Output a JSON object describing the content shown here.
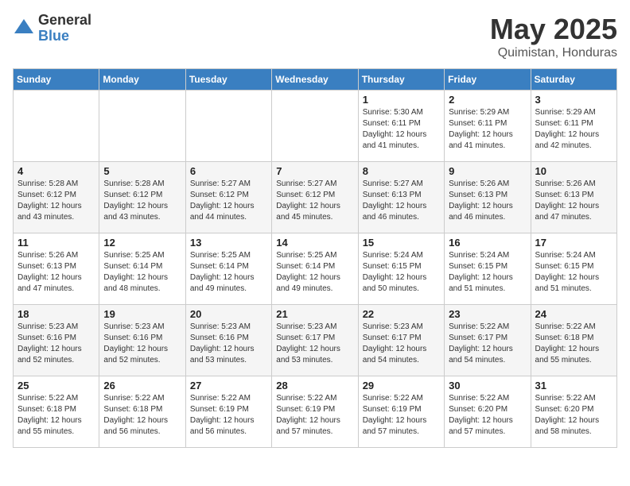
{
  "logo": {
    "general": "General",
    "blue": "Blue"
  },
  "title": "May 2025",
  "location": "Quimistan, Honduras",
  "days_of_week": [
    "Sunday",
    "Monday",
    "Tuesday",
    "Wednesday",
    "Thursday",
    "Friday",
    "Saturday"
  ],
  "weeks": [
    [
      {
        "day": "",
        "info": ""
      },
      {
        "day": "",
        "info": ""
      },
      {
        "day": "",
        "info": ""
      },
      {
        "day": "",
        "info": ""
      },
      {
        "day": "1",
        "info": "Sunrise: 5:30 AM\nSunset: 6:11 PM\nDaylight: 12 hours\nand 41 minutes."
      },
      {
        "day": "2",
        "info": "Sunrise: 5:29 AM\nSunset: 6:11 PM\nDaylight: 12 hours\nand 41 minutes."
      },
      {
        "day": "3",
        "info": "Sunrise: 5:29 AM\nSunset: 6:11 PM\nDaylight: 12 hours\nand 42 minutes."
      }
    ],
    [
      {
        "day": "4",
        "info": "Sunrise: 5:28 AM\nSunset: 6:12 PM\nDaylight: 12 hours\nand 43 minutes."
      },
      {
        "day": "5",
        "info": "Sunrise: 5:28 AM\nSunset: 6:12 PM\nDaylight: 12 hours\nand 43 minutes."
      },
      {
        "day": "6",
        "info": "Sunrise: 5:27 AM\nSunset: 6:12 PM\nDaylight: 12 hours\nand 44 minutes."
      },
      {
        "day": "7",
        "info": "Sunrise: 5:27 AM\nSunset: 6:12 PM\nDaylight: 12 hours\nand 45 minutes."
      },
      {
        "day": "8",
        "info": "Sunrise: 5:27 AM\nSunset: 6:13 PM\nDaylight: 12 hours\nand 46 minutes."
      },
      {
        "day": "9",
        "info": "Sunrise: 5:26 AM\nSunset: 6:13 PM\nDaylight: 12 hours\nand 46 minutes."
      },
      {
        "day": "10",
        "info": "Sunrise: 5:26 AM\nSunset: 6:13 PM\nDaylight: 12 hours\nand 47 minutes."
      }
    ],
    [
      {
        "day": "11",
        "info": "Sunrise: 5:26 AM\nSunset: 6:13 PM\nDaylight: 12 hours\nand 47 minutes."
      },
      {
        "day": "12",
        "info": "Sunrise: 5:25 AM\nSunset: 6:14 PM\nDaylight: 12 hours\nand 48 minutes."
      },
      {
        "day": "13",
        "info": "Sunrise: 5:25 AM\nSunset: 6:14 PM\nDaylight: 12 hours\nand 49 minutes."
      },
      {
        "day": "14",
        "info": "Sunrise: 5:25 AM\nSunset: 6:14 PM\nDaylight: 12 hours\nand 49 minutes."
      },
      {
        "day": "15",
        "info": "Sunrise: 5:24 AM\nSunset: 6:15 PM\nDaylight: 12 hours\nand 50 minutes."
      },
      {
        "day": "16",
        "info": "Sunrise: 5:24 AM\nSunset: 6:15 PM\nDaylight: 12 hours\nand 51 minutes."
      },
      {
        "day": "17",
        "info": "Sunrise: 5:24 AM\nSunset: 6:15 PM\nDaylight: 12 hours\nand 51 minutes."
      }
    ],
    [
      {
        "day": "18",
        "info": "Sunrise: 5:23 AM\nSunset: 6:16 PM\nDaylight: 12 hours\nand 52 minutes."
      },
      {
        "day": "19",
        "info": "Sunrise: 5:23 AM\nSunset: 6:16 PM\nDaylight: 12 hours\nand 52 minutes."
      },
      {
        "day": "20",
        "info": "Sunrise: 5:23 AM\nSunset: 6:16 PM\nDaylight: 12 hours\nand 53 minutes."
      },
      {
        "day": "21",
        "info": "Sunrise: 5:23 AM\nSunset: 6:17 PM\nDaylight: 12 hours\nand 53 minutes."
      },
      {
        "day": "22",
        "info": "Sunrise: 5:23 AM\nSunset: 6:17 PM\nDaylight: 12 hours\nand 54 minutes."
      },
      {
        "day": "23",
        "info": "Sunrise: 5:22 AM\nSunset: 6:17 PM\nDaylight: 12 hours\nand 54 minutes."
      },
      {
        "day": "24",
        "info": "Sunrise: 5:22 AM\nSunset: 6:18 PM\nDaylight: 12 hours\nand 55 minutes."
      }
    ],
    [
      {
        "day": "25",
        "info": "Sunrise: 5:22 AM\nSunset: 6:18 PM\nDaylight: 12 hours\nand 55 minutes."
      },
      {
        "day": "26",
        "info": "Sunrise: 5:22 AM\nSunset: 6:18 PM\nDaylight: 12 hours\nand 56 minutes."
      },
      {
        "day": "27",
        "info": "Sunrise: 5:22 AM\nSunset: 6:19 PM\nDaylight: 12 hours\nand 56 minutes."
      },
      {
        "day": "28",
        "info": "Sunrise: 5:22 AM\nSunset: 6:19 PM\nDaylight: 12 hours\nand 57 minutes."
      },
      {
        "day": "29",
        "info": "Sunrise: 5:22 AM\nSunset: 6:19 PM\nDaylight: 12 hours\nand 57 minutes."
      },
      {
        "day": "30",
        "info": "Sunrise: 5:22 AM\nSunset: 6:20 PM\nDaylight: 12 hours\nand 57 minutes."
      },
      {
        "day": "31",
        "info": "Sunrise: 5:22 AM\nSunset: 6:20 PM\nDaylight: 12 hours\nand 58 minutes."
      }
    ]
  ]
}
